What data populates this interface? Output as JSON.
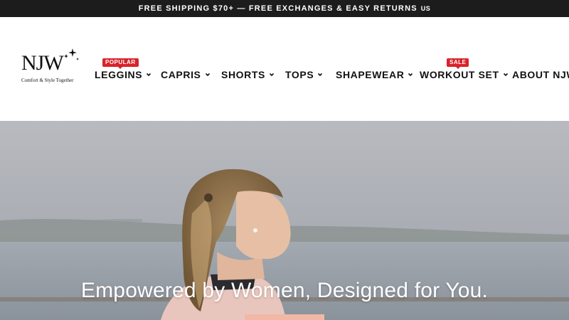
{
  "announcement": {
    "text": "FREE SHIPPING $70+ — FREE EXCHANGES & EASY RETURNS",
    "locale": "US"
  },
  "logo": {
    "letters": "NJW",
    "tagline": "Comfort & Style Together"
  },
  "nav": {
    "items": [
      {
        "label": "LEGGINS",
        "badge": "POPULAR"
      },
      {
        "label": "CAPRIS"
      },
      {
        "label": "SHORTS"
      },
      {
        "label": "TOPS"
      },
      {
        "label": "SHAPEWEAR"
      },
      {
        "label": "WORKOUT SET",
        "badge": "SALE"
      },
      {
        "label": "ABOUT NJW"
      }
    ]
  },
  "hero": {
    "headline": "Empowered by Women, Designed for You."
  },
  "colors": {
    "announcement_bg": "#1c1c1c",
    "badge": "#d8232a",
    "cta": "#f1b8a6"
  }
}
